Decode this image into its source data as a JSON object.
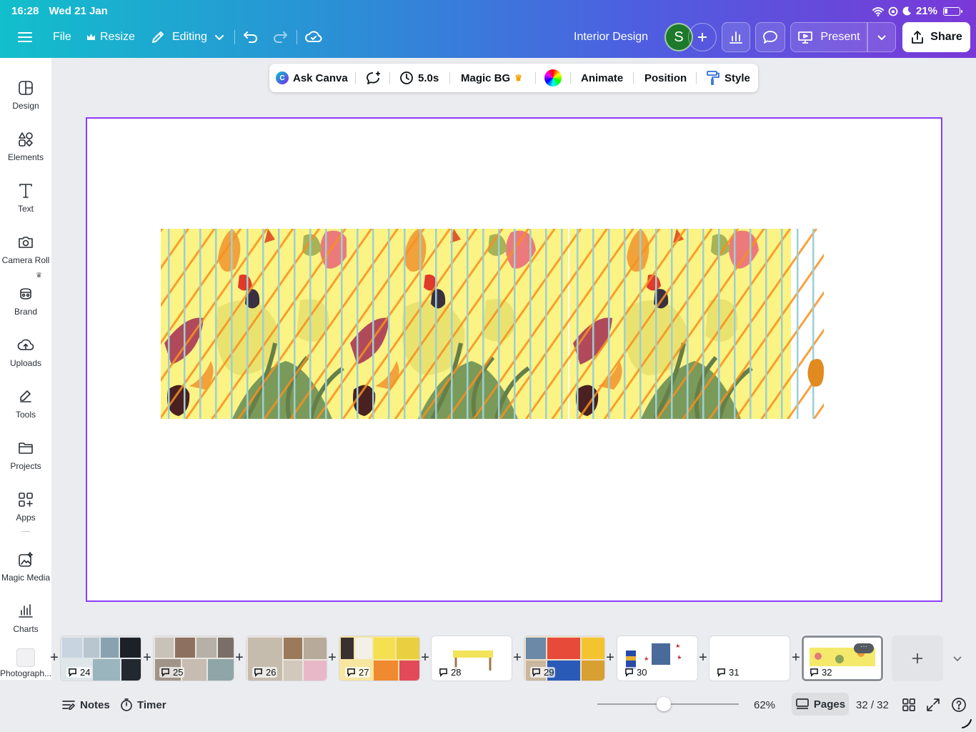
{
  "status_bar": {
    "time": "16:28",
    "date": "Wed 21 Jan",
    "battery": "21%"
  },
  "topbar": {
    "file_label": "File",
    "resize_label": "Resize",
    "editing_label": "Editing",
    "doc_title": "Interior Design",
    "avatar_initial": "S",
    "present_label": "Present",
    "share_label": "Share"
  },
  "sidebar": {
    "items": [
      {
        "label": "Design",
        "icon": "design-icon"
      },
      {
        "label": "Elements",
        "icon": "elements-icon"
      },
      {
        "label": "Text",
        "icon": "text-icon"
      },
      {
        "label": "Camera Roll",
        "icon": "camera-icon"
      },
      {
        "label": "Brand",
        "icon": "brand-icon"
      },
      {
        "label": "Uploads",
        "icon": "upload-icon"
      },
      {
        "label": "Tools",
        "icon": "tools-icon"
      },
      {
        "label": "Projects",
        "icon": "folder-icon"
      },
      {
        "label": "Apps",
        "icon": "apps-icon"
      },
      {
        "label": "Magic Media",
        "icon": "magic-media-icon"
      },
      {
        "label": "Charts",
        "icon": "charts-icon"
      },
      {
        "label": "Photograph...",
        "icon": "photograph-icon"
      }
    ]
  },
  "context_toolbar": {
    "ask_canva": "Ask Canva",
    "duration": "5.0s",
    "magic_bg": "Magic BG",
    "animate": "Animate",
    "position": "Position",
    "style": "Style"
  },
  "pages": {
    "thumbnails": [
      {
        "number": "24"
      },
      {
        "number": "25"
      },
      {
        "number": "26"
      },
      {
        "number": "27"
      },
      {
        "number": "28"
      },
      {
        "number": "29"
      },
      {
        "number": "30"
      },
      {
        "number": "31"
      },
      {
        "number": "32"
      }
    ],
    "more_label": "···"
  },
  "bottom_bar": {
    "notes_label": "Notes",
    "timer_label": "Timer",
    "zoom_level": "62%",
    "zoom_fraction": 0.47,
    "pages_label": "Pages",
    "page_counter": "32 / 32"
  },
  "colors": {
    "accent": "#8b3dff",
    "banner_yellow": "#fbf383",
    "stripe_orange": "#f5901f",
    "stripe_blue": "#9ccfd6"
  }
}
